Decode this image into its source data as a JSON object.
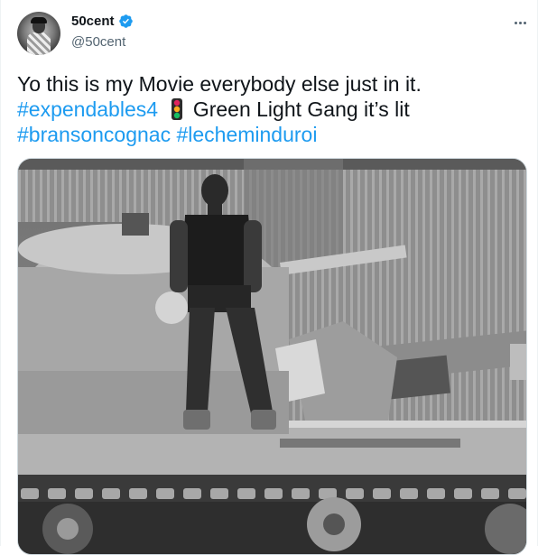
{
  "author": {
    "display_name": "50cent",
    "handle": "@50cent",
    "verified": true,
    "avatar_icon": "user-avatar"
  },
  "tweet": {
    "line1": "Yo this is my Movie everybody else just in it.",
    "hashtag_expendables": "#expendables4",
    "emoji": "traffic-light-icon",
    "line2_text": "Green Light Gang it’s lit",
    "hashtag_bransoncognac": "#bransoncognac",
    "hashtag_lecheminduroi": "#lecheminduroi"
  },
  "media": {
    "type": "photo",
    "icon": "photo-icon"
  },
  "colors": {
    "link": "#1d9bf0",
    "text": "#0f1419",
    "secondary": "#536471",
    "verified_badge": "#1d9bf0"
  }
}
